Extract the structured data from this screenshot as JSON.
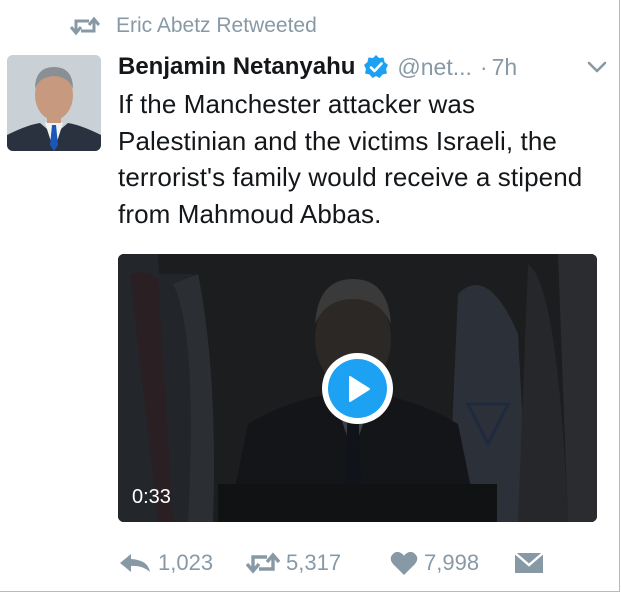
{
  "retweet_context": {
    "text": "Eric Abetz Retweeted",
    "icon": "retweet-icon"
  },
  "tweet": {
    "author_name": "Benjamin Netanyahu",
    "handle": "@net...",
    "separator": "·",
    "time": "7h",
    "verified": true,
    "text": "If the Manchester attacker was Palestinian and the victims Israeli, the terrorist's family would receive a stipend from Mahmoud Abbas.",
    "video": {
      "duration": "0:33",
      "play_icon": "play-icon"
    },
    "actions": {
      "reply_count": "1,023",
      "retweet_count": "5,317",
      "like_count": "7,998"
    }
  },
  "colors": {
    "accent": "#1da1f2",
    "muted": "#8899a6",
    "text": "#14171a"
  }
}
